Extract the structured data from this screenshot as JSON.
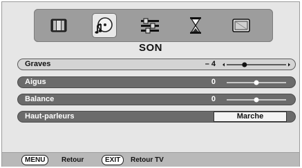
{
  "menu": {
    "title": "SON",
    "tabs": [
      {
        "icon": "tv-picture-icon"
      },
      {
        "icon": "sound-icon",
        "active": true
      },
      {
        "icon": "settings-sliders-icon"
      },
      {
        "icon": "timer-hourglass-icon"
      },
      {
        "icon": "screen-icon"
      }
    ],
    "rows": [
      {
        "label": "Graves",
        "value": "– 4",
        "slider_level": -4,
        "slider_range": [
          -10,
          10
        ],
        "arrows": true
      },
      {
        "label": "Aigus",
        "value": "0",
        "slider_level": 0,
        "slider_range": [
          -10,
          10
        ],
        "arrows": false
      },
      {
        "label": "Balance",
        "value": "0",
        "slider_level": 0,
        "slider_range": [
          -10,
          10
        ],
        "arrows": false
      },
      {
        "label": "Haut-parleurs",
        "value": "Marche"
      }
    ]
  },
  "footer": {
    "menu_key": "MENU",
    "menu_action": "Retour",
    "exit_key": "EXIT",
    "exit_action": "Retour TV"
  },
  "colors": {
    "background": "#e6e6e6",
    "row_selected": "#d4d4d4",
    "row_normal": "#6b6b6b",
    "icon_bar": "#9d9d9d"
  }
}
